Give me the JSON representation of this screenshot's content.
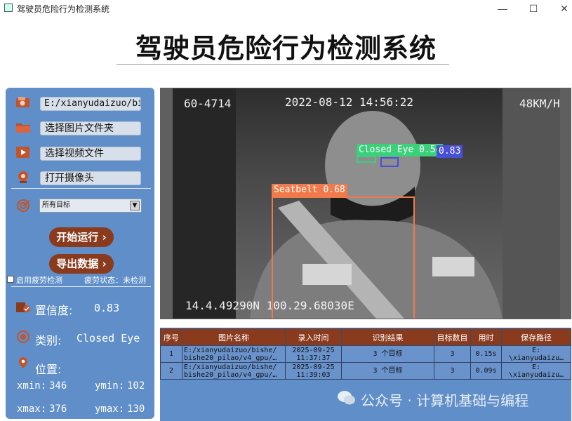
{
  "window": {
    "title": "驾驶员危险行为检测系统",
    "min": "—",
    "max": "☐",
    "close": "✕"
  },
  "main_title": "驾驶员危险行为检测系统",
  "sidebar": {
    "path_value": "E:/xianyudaizuo/bis",
    "select_folder": "选择图片文件夹",
    "select_video": "选择视频文件",
    "open_camera": "打开摄像头",
    "target_select": "所有目标",
    "run_button": "开始运行 ›",
    "export_button": "导出数据 ›",
    "fatigue_checkbox": "启用疲劳检测",
    "fatigue_status": "疲劳状态：未检测",
    "confidence_label": "置信度:",
    "confidence_value": "0.83",
    "class_label": "类别:",
    "class_value": "Closed Eye",
    "position_label": "位置:",
    "xmin_label": "xmin:",
    "xmin": "346",
    "ymin_label": "ymin:",
    "ymin": "102",
    "xmax_label": "xmax:",
    "xmax": "376",
    "ymax_label": "ymax:",
    "ymax": "130"
  },
  "image": {
    "plate": "60-4714",
    "timestamp": "2022-08-12 14:56:22",
    "speed": "48KM/H",
    "gps": "14.4.49290N 100.29.68030E",
    "detections": [
      {
        "label": "Closed Eye 0.54",
        "color": "#3ad17a"
      },
      {
        "label": "0.83",
        "color": "#4a4fd8"
      },
      {
        "label": "Seatbelt 0.68",
        "color": "#f07a4a"
      }
    ]
  },
  "table": {
    "headers": [
      "序号",
      "图片名称",
      "录入时间",
      "识别结果",
      "目标数目",
      "用时",
      "保存路径"
    ],
    "rows": [
      [
        "1",
        "E:/xianyudaizuo/bishe/ bishe20_pilao/v4_gpu/…",
        "2025-09-25 11:37:37",
        "3 个目标",
        "3",
        "0.15s",
        "E: \\xianyudaizu…"
      ],
      [
        "2",
        "E:/xianyudaizuo/bishe/ bishe20_pilao/v4_gpu/…",
        "2025-09-25 11:39:03",
        "3 个目标",
        "3",
        "0.09s",
        "E: \\xianyudaizu…"
      ]
    ]
  },
  "watermark": "公众号 · 计算机基础与编程"
}
